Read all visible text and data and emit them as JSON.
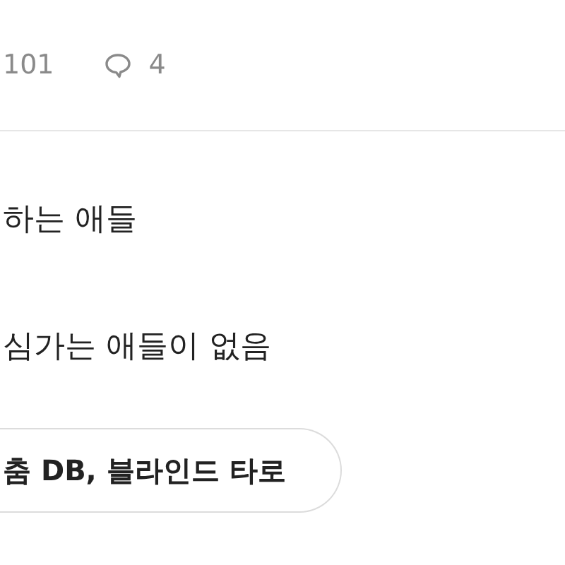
{
  "stats": {
    "likes": "101",
    "comments": "4"
  },
  "body_lines": [
    "하는 애들",
    "심가는 애들이 없음"
  ],
  "tag_pill": "춤 DB, 블라인드 타로"
}
